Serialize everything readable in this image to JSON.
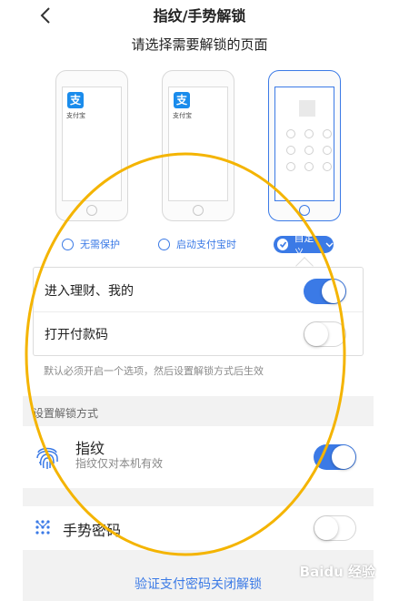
{
  "header": {
    "back_icon": "chevron-left-icon",
    "title": "指纹/手势解锁"
  },
  "subtitle": "请选择需要解锁的页面",
  "phones": [
    {
      "app_icon_char": "支",
      "app_label": "支付宝"
    },
    {
      "app_icon_char": "支",
      "app_label": "支付宝"
    },
    {
      "type": "lock-pattern"
    }
  ],
  "options": [
    {
      "label": "无需保护",
      "selected": false
    },
    {
      "label": "启动支付宝时",
      "selected": false
    },
    {
      "label": "自定义",
      "selected": true
    }
  ],
  "custom_popup": {
    "rows": [
      {
        "label": "进入理财、我的",
        "on": true
      },
      {
        "label": "打开付款码",
        "on": false
      }
    ]
  },
  "note": "默认必须开启一个选项，然后设置解锁方式后生效",
  "unlock_section": {
    "title": "设置解锁方式",
    "fingerprint": {
      "title": "指纹",
      "subtitle": "指纹仅对本机有效",
      "on": true
    },
    "gesture": {
      "label": "手势密码",
      "on": false
    }
  },
  "bottom_link": "验证支付密码关闭解锁",
  "watermark": "Baidu 经验",
  "colors": {
    "accent": "#3b7ae6",
    "annotation": "#f4b400"
  }
}
